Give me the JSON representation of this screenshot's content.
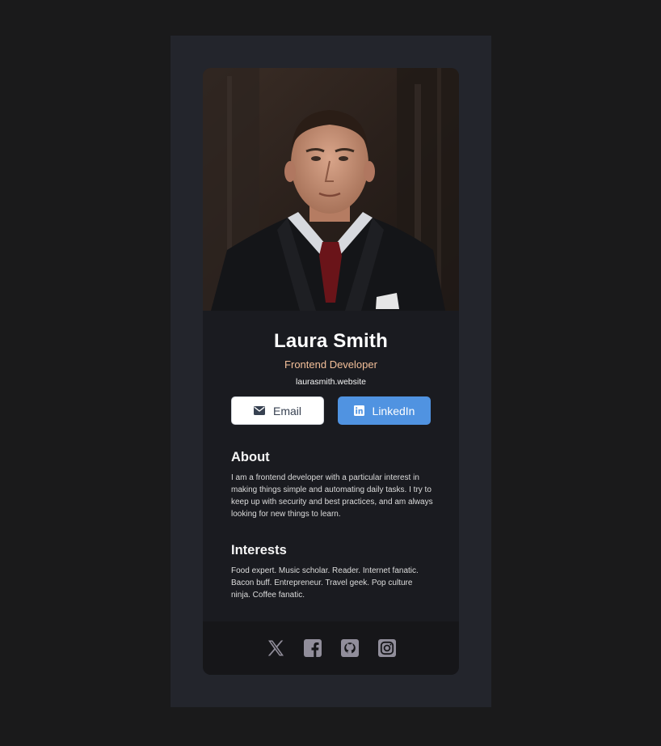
{
  "profile": {
    "name": "Laura Smith",
    "role": "Frontend Developer",
    "website": "laurasmith.website"
  },
  "buttons": {
    "email": {
      "label": "Email",
      "icon": "envelope-icon"
    },
    "linkedin": {
      "label": "LinkedIn",
      "icon": "linkedin-icon"
    }
  },
  "about": {
    "heading": "About",
    "text": "I am a frontend developer with a particular interest in making things simple and automating daily tasks. I try to keep up with security and best practices, and am always looking for new things to learn."
  },
  "interests": {
    "heading": "Interests",
    "text": "Food expert. Music scholar. Reader. Internet fanatic. Bacon buff. Entrepreneur. Travel geek. Pop culture ninja. Coffee fanatic."
  },
  "footer": {
    "icons": [
      "x-icon",
      "facebook-icon",
      "github-icon",
      "instagram-icon"
    ]
  },
  "colors": {
    "page_background": "#1a1a1b",
    "frame": "#23252c",
    "card": "#1a1b20",
    "footer": "#161619",
    "accent_role": "#f3bf99",
    "linkedin_button": "#5093e1",
    "social_icon": "#918e9b"
  }
}
